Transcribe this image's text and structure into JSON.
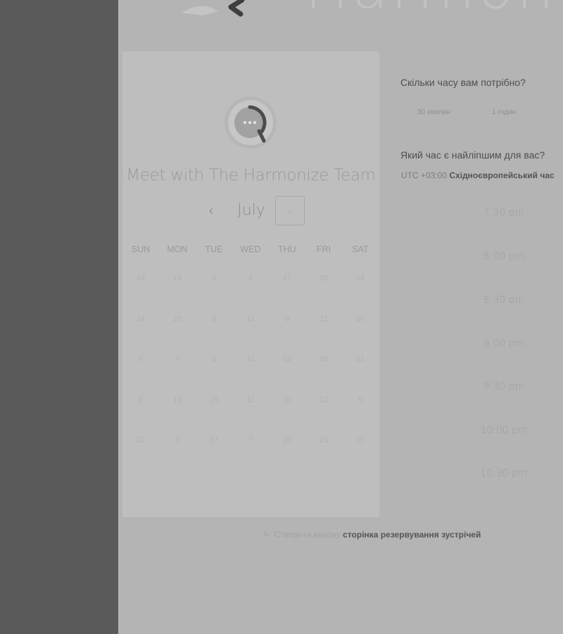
{
  "brand": {
    "name": "Harmonize"
  },
  "card": {
    "title": "Meet with The Harmonize Team",
    "month": "July",
    "prev_label": "‹",
    "next_label": "›",
    "weekdays": [
      "SUN",
      "MON",
      "TUE",
      "WED",
      "THU",
      "FRI",
      "SAT"
    ],
    "weeks": [
      [
        "16",
        "18",
        "3",
        "6",
        "17",
        "28",
        "18"
      ],
      [
        "24",
        "20",
        "8",
        "11",
        "9",
        "21",
        "26"
      ],
      [
        "6",
        "7",
        "8",
        "31",
        "12",
        "18",
        "21"
      ],
      [
        "8",
        "13",
        "19",
        "11",
        "10",
        "12",
        "9"
      ],
      [
        "22",
        "3",
        "17",
        "7",
        "28",
        "25",
        "15"
      ]
    ]
  },
  "duration": {
    "question": "Скільки часу вам потрібно?",
    "options": [
      "30 хвилин",
      "1 годин"
    ]
  },
  "time": {
    "question": "Який час є найліпшим для вас?",
    "tz_offset": "UTC +03:00",
    "tz_name": "Східноєвропейський час",
    "slots": [
      "7:30 pm",
      "8:00 pm",
      "8:30 pm",
      "9:00 pm",
      "9:30 pm",
      "10:00 pm",
      "10:30 pm"
    ]
  },
  "footer": {
    "icon": "ruler-pencil-icon",
    "prefix": "Створити власну",
    "link": "сторінка резервування зустрічей"
  },
  "colors": {
    "page_background": "#b4b4b4",
    "sidebar": "#5a5a5a",
    "card": "#bebebe"
  }
}
